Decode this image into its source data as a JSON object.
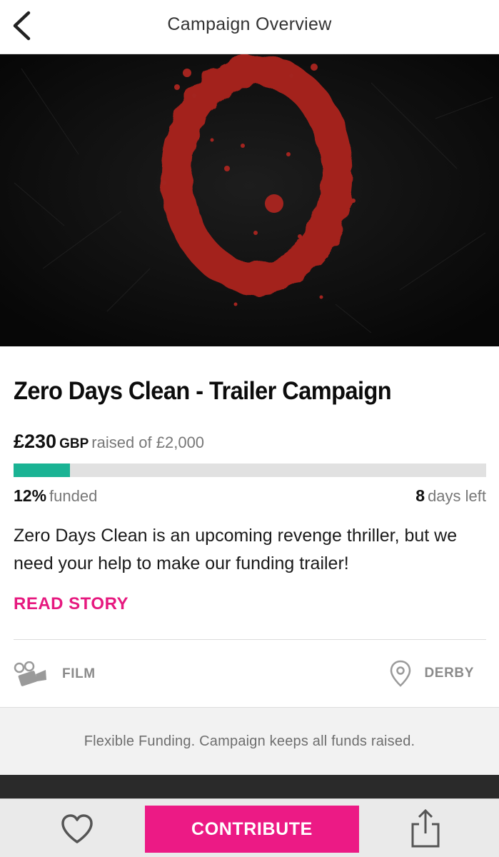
{
  "header": {
    "title": "Campaign Overview",
    "back_icon": "chevron-left-icon"
  },
  "campaign": {
    "title": "Zero Days Clean - Trailer Campaign",
    "raised_amount": "£230",
    "raised_currency": "GBP",
    "raised_of": "raised of £2,000",
    "progress_fraction": 0.12,
    "funded_value": "12%",
    "funded_label": "funded",
    "days_value": "8",
    "days_label": "days left",
    "blurb": "Zero Days Clean is an upcoming revenge thriller, but we need your help to make our funding trailer!",
    "read_story": "READ STORY",
    "category": "FILM",
    "location": "DERBY"
  },
  "notice": {
    "text": "Flexible Funding. Campaign keeps all funds raised."
  },
  "bottom_bar": {
    "contribute_label": "CONTRIBUTE"
  },
  "colors": {
    "accent": "#ec1a85",
    "progress": "#1ab394",
    "hero_mark": "#a3241f"
  }
}
